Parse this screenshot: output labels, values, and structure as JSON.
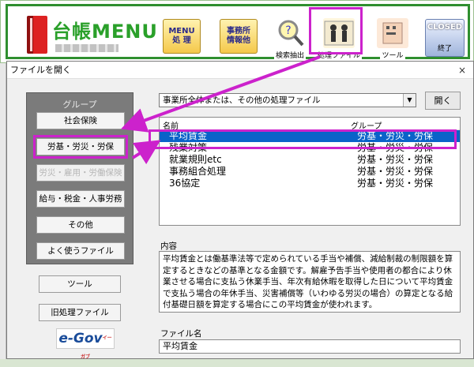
{
  "app": {
    "logo_title": "台帳MENU",
    "buttons": {
      "menu": "MENU\n処 理",
      "office": "事務所\n情報他"
    },
    "icons": {
      "search": {
        "icon": "magnifier-icon",
        "label": "検索抽出"
      },
      "process": {
        "icon": "worker-icon",
        "label": "処理ファイル"
      },
      "tool": {
        "icon": "tool-icon",
        "label": "ツール"
      },
      "closed": {
        "title": "CLOSED",
        "label": "終了"
      }
    }
  },
  "dialog": {
    "title": "ファイルを開く",
    "close": "×",
    "group": {
      "title": "グループ",
      "items": [
        {
          "label": "社会保険",
          "enabled": true
        },
        {
          "label": "労基・労災・労保",
          "enabled": true
        },
        {
          "label": "労災・雇用・労働保険",
          "enabled": false
        },
        {
          "label": "給与・税金・人事労務",
          "enabled": true
        },
        {
          "label": "その他",
          "enabled": true
        },
        {
          "label": "よく使うファイル",
          "enabled": true
        }
      ]
    },
    "tools_button": "ツール",
    "old_files_button": "旧処理ファイル",
    "egov": {
      "text": "e-Gov",
      "small": "イーガブ"
    },
    "combo": {
      "value": "事業所全体または、その他の処理ファイル",
      "arrow": "▼"
    },
    "open_button": "開く",
    "list": {
      "headers": {
        "name": "名前",
        "group": "グループ"
      },
      "rows": [
        {
          "name": "平均賃金",
          "group": "労基・労災・労保",
          "selected": true
        },
        {
          "name": "残業対策",
          "group": "労基・労災・労保",
          "selected": false
        },
        {
          "name": "就業規則etc",
          "group": "労基・労災・労保",
          "selected": false
        },
        {
          "name": "事務組合処理",
          "group": "労基・労災・労保",
          "selected": false
        },
        {
          "name": "36協定",
          "group": "労基・労災・労保",
          "selected": false
        }
      ]
    },
    "content_label": "内容",
    "content_text": "平均賃金とは働基準法等で定められている手当や補償、減給制裁の制限額を算定するときなどの基準となる金額です。解雇予告手当や使用者の都合により休業させる場合に支払う休業手当、年次有給休暇を取得した日について平均賃金で支払う場合の年休手当、災害補償等（いわゆる労災の場合）の算定となる給付基礎日額を算定する場合にこの平均賃金が使われます。",
    "filename_label": "ファイル名",
    "filename_value": "平均賃金"
  },
  "colors": {
    "highlight": "#cc22cc",
    "selection": "#0a63c9",
    "brand_green": "#2aa02a"
  }
}
